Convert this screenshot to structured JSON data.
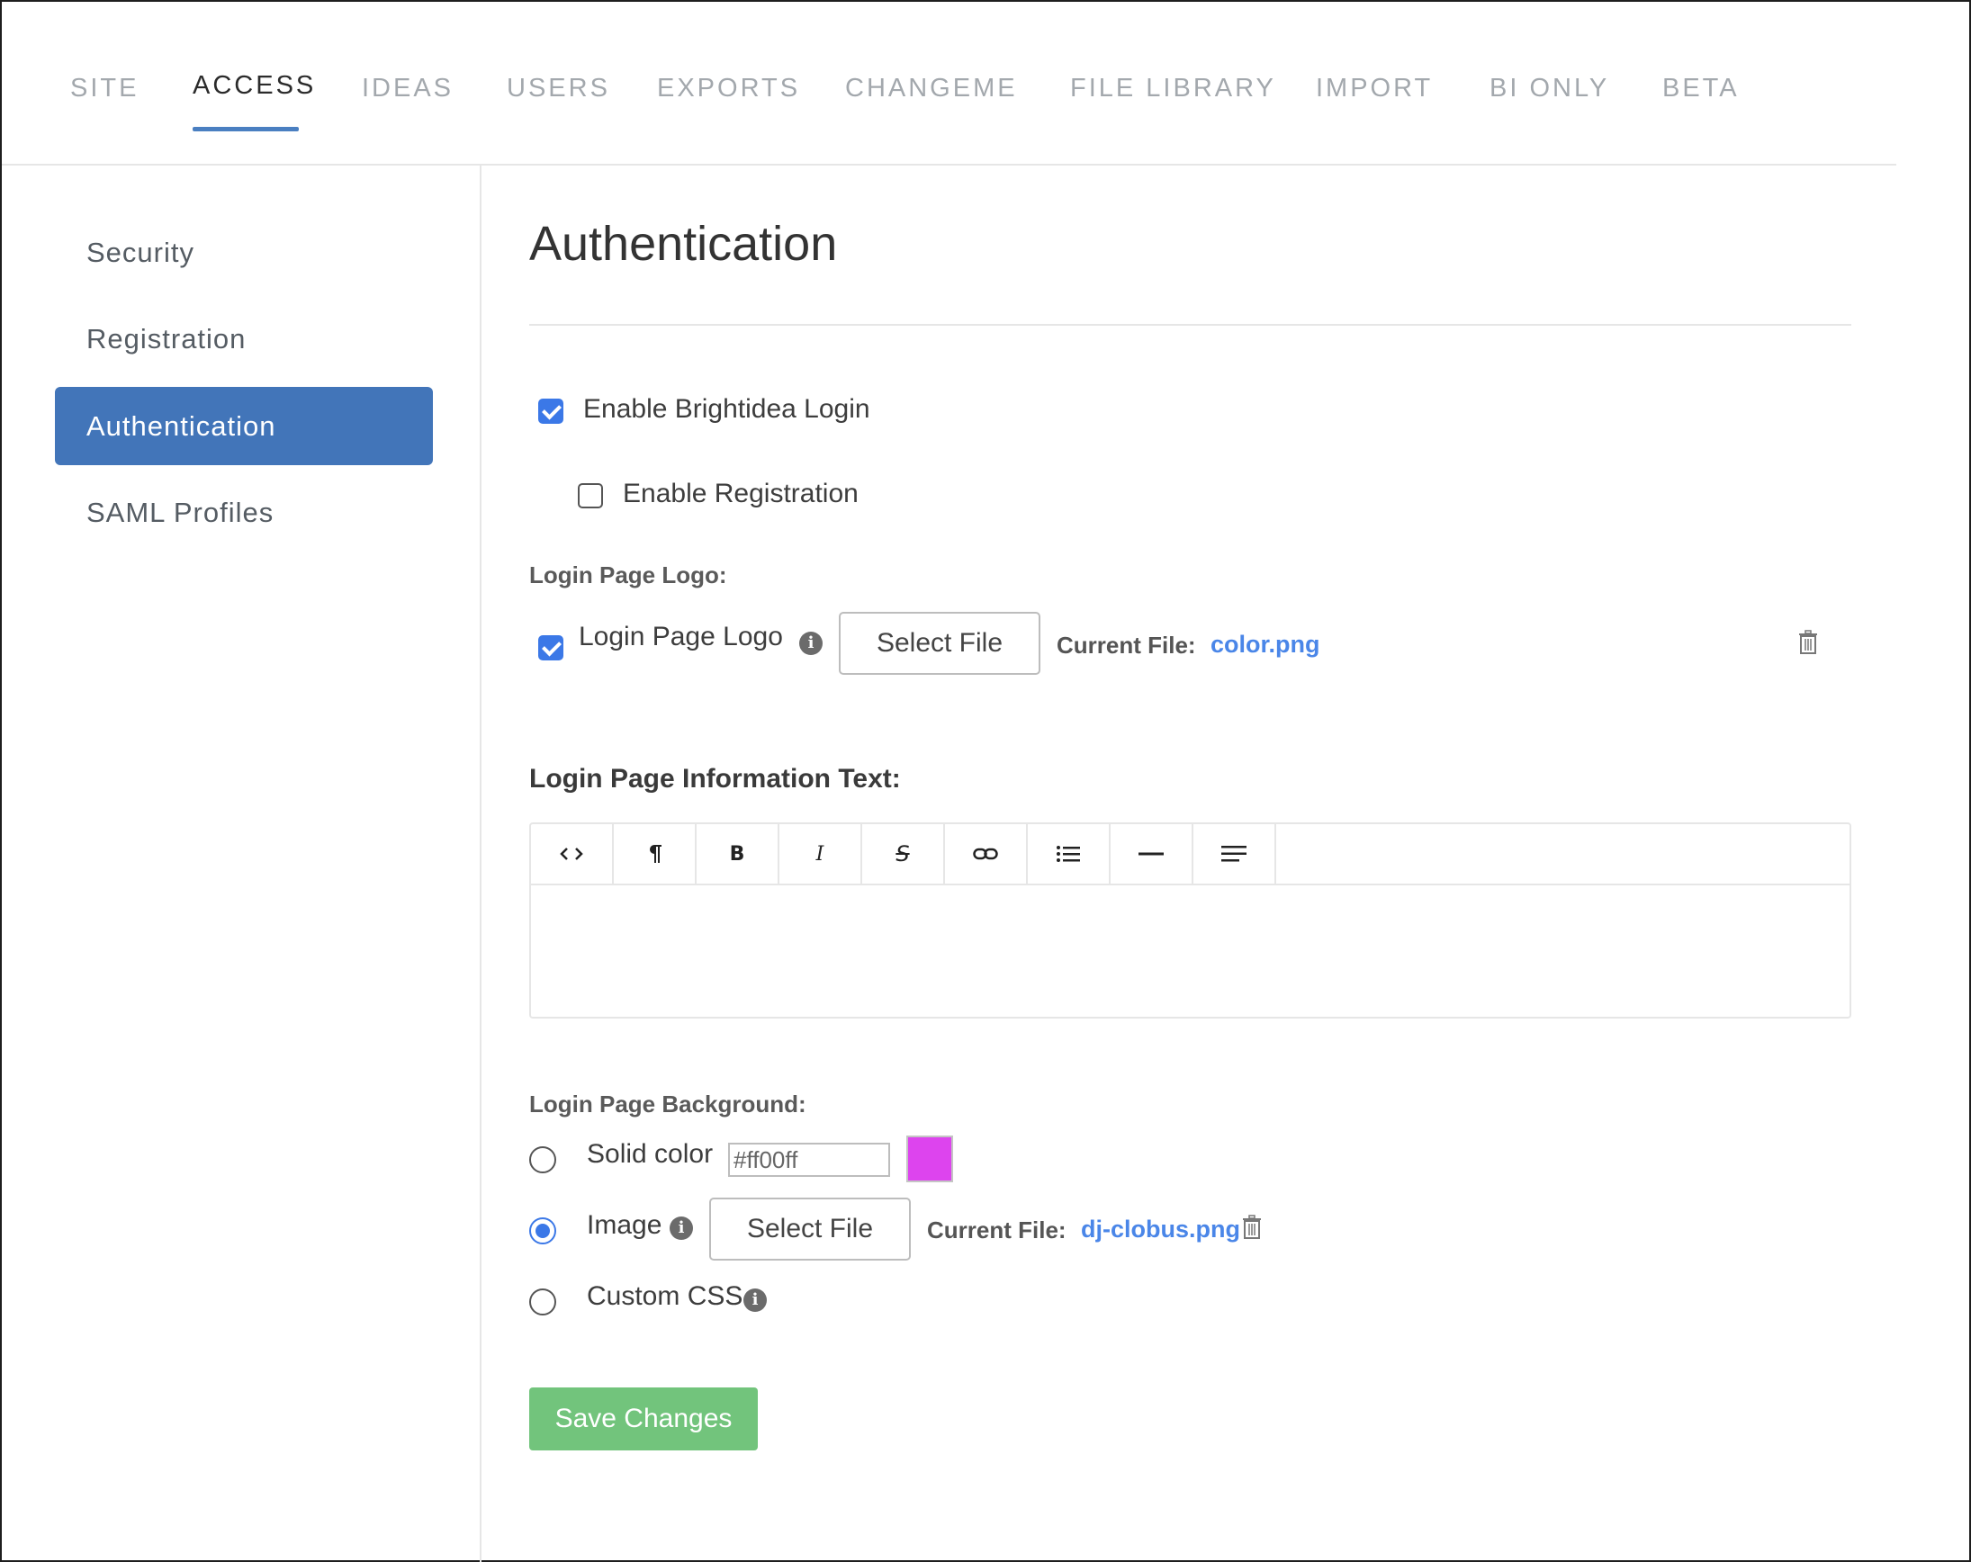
{
  "nav": {
    "tabs": [
      {
        "label": "SITE"
      },
      {
        "label": "ACCESS"
      },
      {
        "label": "IDEAS"
      },
      {
        "label": "USERS"
      },
      {
        "label": "EXPORTS"
      },
      {
        "label": "CHANGEME"
      },
      {
        "label": "FILE LIBRARY"
      },
      {
        "label": "IMPORT"
      },
      {
        "label": "BI ONLY"
      },
      {
        "label": "BETA"
      }
    ],
    "active_tab": "ACCESS"
  },
  "sidebar": {
    "items": [
      {
        "label": "Security"
      },
      {
        "label": "Registration"
      },
      {
        "label": "Authentication"
      },
      {
        "label": "SAML Profiles"
      }
    ],
    "active_item": "Authentication"
  },
  "main": {
    "title": "Authentication",
    "enable_login": {
      "label": "Enable Brightidea Login",
      "checked": true
    },
    "enable_registration": {
      "label": "Enable Registration",
      "checked": false
    },
    "logo_section": {
      "heading": "Login Page Logo:",
      "checkbox_label": "Login Page Logo",
      "checked": true,
      "select_file_label": "Select File",
      "current_file_label": "Current File:",
      "current_file": "color.png"
    },
    "info_text": {
      "heading": "Login Page Information Text:",
      "toolbar": [
        "code",
        "paragraph",
        "bold",
        "italic",
        "strikethrough",
        "link",
        "list",
        "horizontal-rule",
        "align"
      ]
    },
    "background": {
      "heading": "Login Page Background:",
      "solid_color": {
        "label": "Solid color",
        "value": "#ff00ff",
        "swatch": "#dd44ee",
        "checked": false
      },
      "image": {
        "label": "Image",
        "checked": true,
        "select_file_label": "Select File",
        "current_file_label": "Current File:",
        "current_file": "dj-clobus.png"
      },
      "custom_css": {
        "label": "Custom CSS",
        "checked": false
      }
    },
    "save_label": "Save Changes"
  },
  "colors": {
    "accent": "#4275b9",
    "checkbox": "#3b78e7",
    "link": "#4a86e8",
    "save": "#72c47c"
  }
}
